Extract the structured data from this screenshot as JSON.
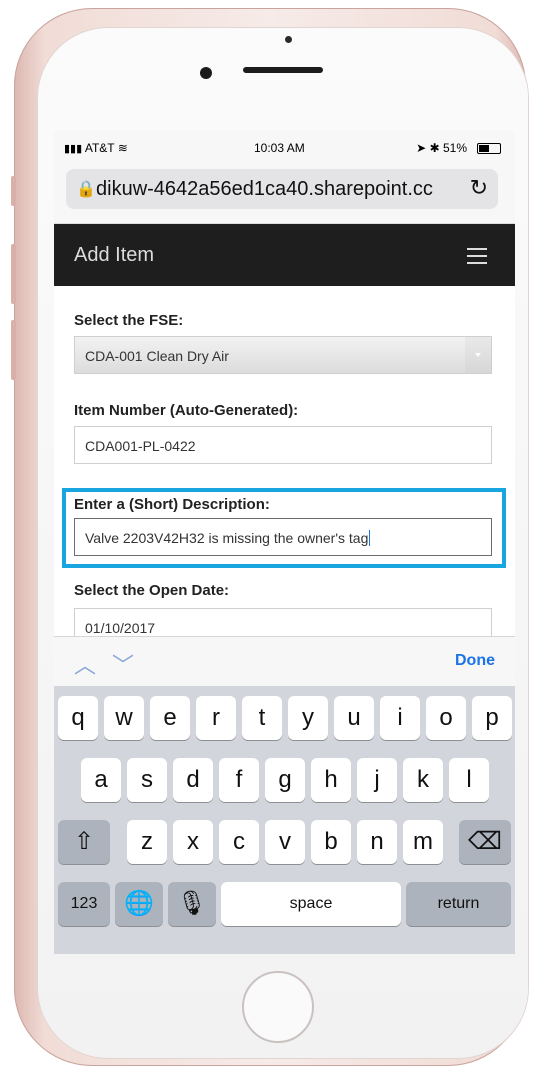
{
  "status_bar": {
    "carrier": "AT&T",
    "time": "10:03 AM",
    "battery": "51%"
  },
  "browser": {
    "url": "dikuw-4642a56ed1ca40.sharepoint.cc"
  },
  "nav": {
    "title": "Add Item"
  },
  "form": {
    "fse_label": "Select the FSE:",
    "fse_value": "CDA-001 Clean Dry Air",
    "item_number_label": "Item Number (Auto-Generated):",
    "item_number_value": "CDA001-PL-0422",
    "description_label": "Enter a (Short) Description:",
    "description_value": "Valve 2203V42H32 is missing the owner's tag",
    "open_date_label": "Select the Open Date:",
    "open_date_value": "01/10/2017"
  },
  "keyboard": {
    "accessory": {
      "done_label": "Done"
    },
    "rows": {
      "row1": [
        "q",
        "w",
        "e",
        "r",
        "t",
        "y",
        "u",
        "i",
        "o",
        "p"
      ],
      "row2": [
        "a",
        "s",
        "d",
        "f",
        "g",
        "h",
        "j",
        "k",
        "l"
      ],
      "row3": [
        "z",
        "x",
        "c",
        "v",
        "b",
        "n",
        "m"
      ]
    },
    "bottom": {
      "numbers_label": "123",
      "space_label": "space",
      "return_label": "return"
    }
  },
  "icons": {
    "signal": "signal-bars-icon",
    "wifi": "wifi-icon",
    "location": "location-arrow-icon",
    "bluetooth": "bluetooth-icon",
    "battery": "battery-icon",
    "lock": "lock-icon",
    "reload": "reload-icon",
    "menu": "hamburger-menu-icon",
    "prev": "chevron-up-icon",
    "next": "chevron-down-icon",
    "shift": "shift-icon",
    "backspace": "backspace-icon",
    "globe": "globe-icon",
    "mic": "microphone-icon"
  }
}
